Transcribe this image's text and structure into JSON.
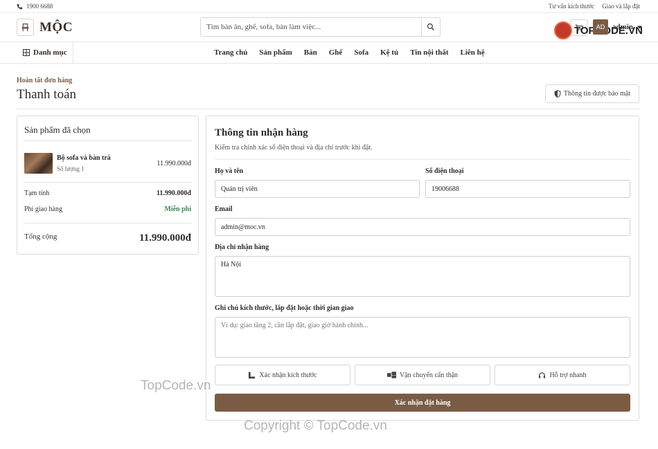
{
  "topbar": {
    "phone": "1900 6688",
    "links": [
      "Tư vấn kích thước",
      "Giao và lắp đặt"
    ]
  },
  "header": {
    "logo_text": "MỘC",
    "search_placeholder": "Tìm bàn ăn, ghế, sofa, bàn làm việc...",
    "avatar_initials": "AD",
    "username": "admin",
    "watermark_logo": "TOPCODE.VN"
  },
  "nav": {
    "category_label": "Danh mục",
    "links": [
      "Trang chủ",
      "Sản phẩm",
      "Bàn",
      "Ghế",
      "Sofa",
      "Kệ tủ",
      "Tin nội thất",
      "Liên hệ"
    ]
  },
  "page": {
    "breadcrumb": "Hoàn tất đơn hàng",
    "title": "Thanh toán",
    "secure_label": "Thông tin được bảo mật"
  },
  "order": {
    "heading": "Sản phẩm đã chọn",
    "item": {
      "name": "Bộ sofa và bàn trà",
      "qty": "Số lượng 1",
      "price": "11.990.000đ"
    },
    "subtotal_label": "Tạm tính",
    "subtotal_value": "11.990.000đ",
    "shipping_label": "Phí giao hàng",
    "shipping_value": "Miễn phí",
    "total_label": "Tổng cộng",
    "total_value": "11.990.000đ"
  },
  "form": {
    "heading": "Thông tin nhận hàng",
    "subtitle": "Kiểm tra chính xác số điện thoại và địa chỉ trước khi đặt.",
    "name_label": "Họ và tên",
    "name_value": "Quản trị viên",
    "phone_label": "Số điện thoại",
    "phone_value": "19006688",
    "email_label": "Email",
    "email_value": "admin@moc.vn",
    "address_label": "Địa chỉ nhận hàng",
    "address_value": "Hà Nội",
    "note_label": "Ghi chú kích thước, lắp đặt hoặc thời gian giao",
    "note_placeholder": "Ví dụ: giao tầng 2, cần lắp đặt, giao giờ hành chính...",
    "features": [
      "Xác nhận kích thước",
      "Vận chuyển cẩn thận",
      "Hỗ trợ nhanh"
    ],
    "submit_label": "Xác nhận đặt hàng"
  },
  "watermarks": [
    "TopCode.vn",
    "Copyright © TopCode.vn"
  ],
  "colors": {
    "accent": "#7a5c45",
    "free": "#3a8a52"
  }
}
